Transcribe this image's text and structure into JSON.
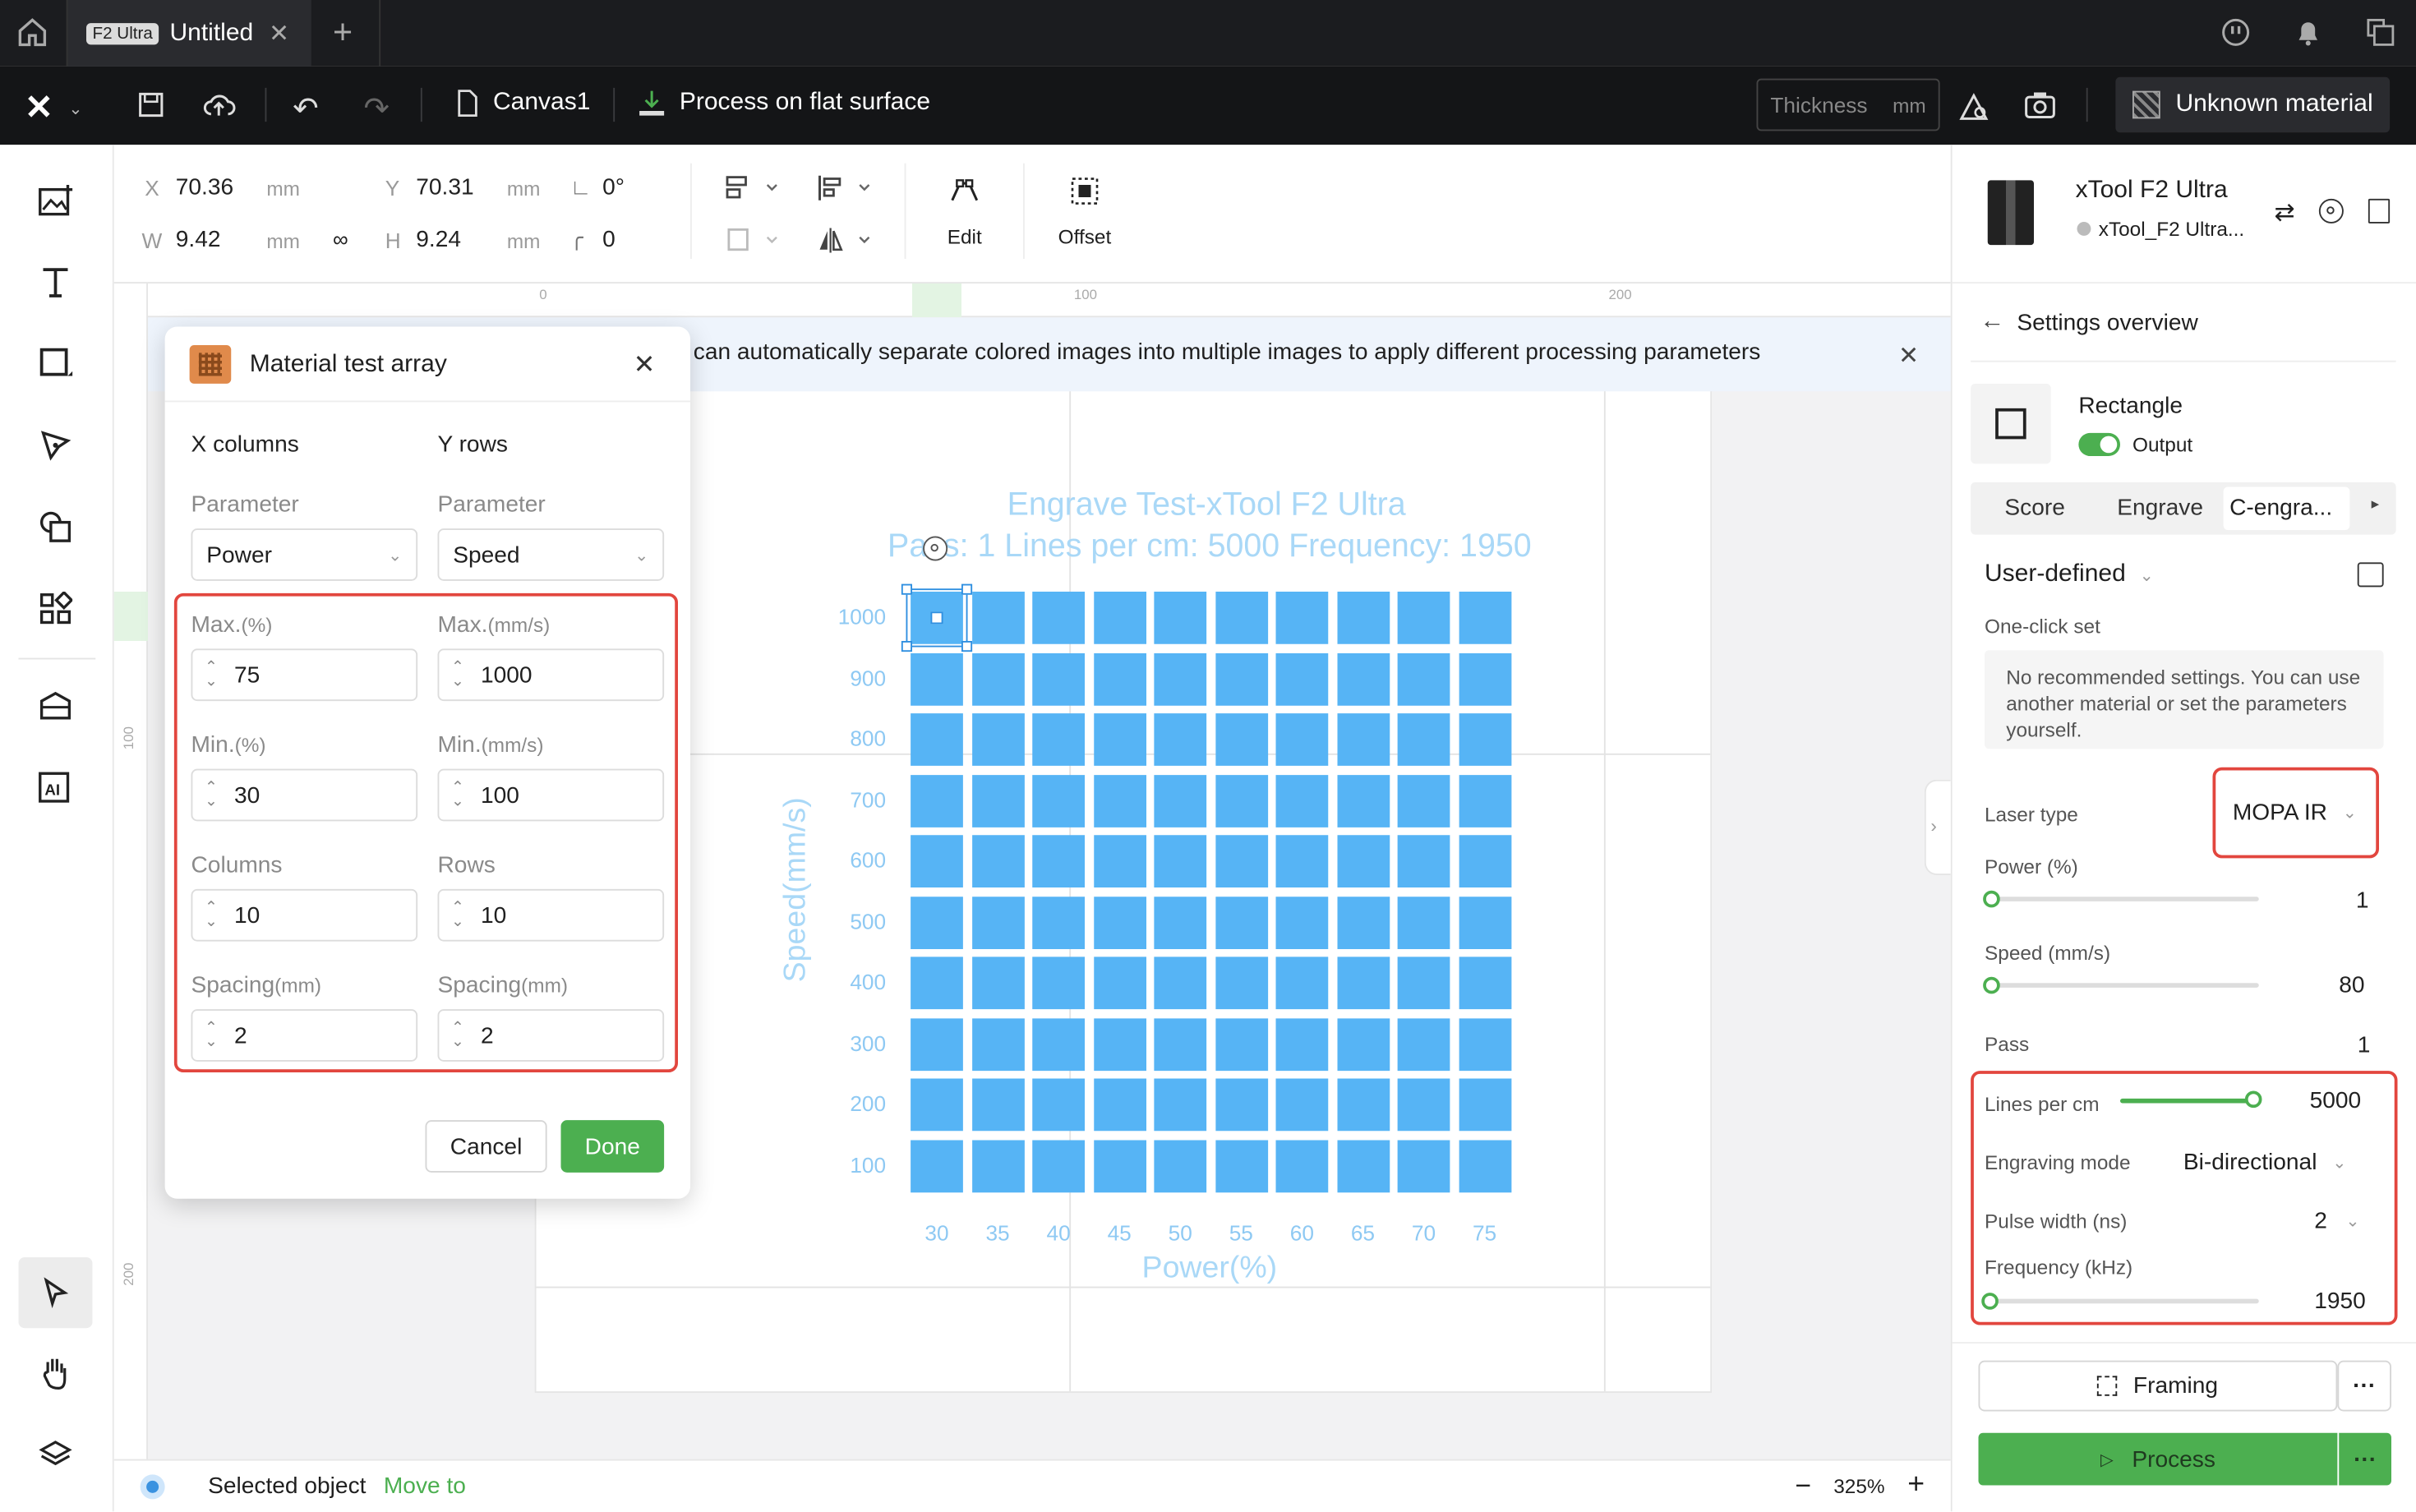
{
  "tabbar": {
    "badge": "F2 Ultra",
    "tab_title": "Untitled"
  },
  "toolbar": {
    "canvas_name": "Canvas1",
    "process_mode": "Process on flat surface",
    "thickness_placeholder": "Thickness",
    "thickness_unit": "mm",
    "material": "Unknown material"
  },
  "props": {
    "x_label": "X",
    "x": "70.36",
    "y_label": "Y",
    "y": "70.31",
    "w_label": "W",
    "w": "9.42",
    "h_label": "H",
    "h": "9.24",
    "unit": "mm",
    "rotation": "0°",
    "corner": "0",
    "edit": "Edit",
    "offset": "Offset"
  },
  "rulers": {
    "h": [
      "0",
      "100",
      "200"
    ],
    "v": [
      "100",
      "200"
    ]
  },
  "banner": {
    "text": "can automatically separate colored images into multiple images to apply different processing parameters"
  },
  "canvas": {
    "title_line1": "Engrave Test-xTool F2 Ultra",
    "title_line2": "Pass: 1 Lines per cm: 5000 Frequency: 1950",
    "y_axis": "Speed(mm/s)",
    "x_axis": "Power(%)",
    "speed_labels": [
      "1000",
      "900",
      "800",
      "700",
      "600",
      "500",
      "400",
      "300",
      "200",
      "100"
    ],
    "power_labels": [
      "30",
      "35",
      "40",
      "45",
      "50",
      "55",
      "60",
      "65",
      "70",
      "75"
    ]
  },
  "dialog": {
    "title": "Material test array",
    "x_columns": "X columns",
    "y_rows": "Y rows",
    "parameter_label": "Parameter",
    "x_param": "Power",
    "y_param": "Speed",
    "x_max_label": "Max.",
    "x_max_unit": "(%)",
    "x_max": "75",
    "y_max_label": "Max.",
    "y_max_unit": "(mm/s)",
    "y_max": "1000",
    "x_min_label": "Min.",
    "x_min_unit": "(%)",
    "x_min": "30",
    "y_min_label": "Min.",
    "y_min_unit": "(mm/s)",
    "y_min": "100",
    "columns_label": "Columns",
    "columns": "10",
    "rows_label": "Rows",
    "rows": "10",
    "spacing_label": "Spacing",
    "spacing_unit": "(mm)",
    "x_spacing": "2",
    "y_spacing": "2",
    "cancel": "Cancel",
    "done": "Done"
  },
  "right_panel": {
    "device_name": "xTool F2 Ultra",
    "device_conn": "xTool_F2 Ultra...",
    "settings_overview": "Settings overview",
    "shape": "Rectangle",
    "output_label": "Output",
    "output_on": true,
    "tabs": [
      "Score",
      "Engrave",
      "C-engra..."
    ],
    "preset": "User-defined",
    "one_click": "One-click set",
    "no_recommend": "No recommended settings. You can use another material or set the parameters yourself.",
    "laser_type_label": "Laser type",
    "laser_type": "MOPA IR",
    "power_label": "Power (%)",
    "power": "1",
    "power_fraction": 0,
    "speed_label": "Speed (mm/s)",
    "speed": "80",
    "speed_fraction": 0,
    "pass_label": "Pass",
    "pass": "1",
    "lpc_label": "Lines per cm",
    "lpc": "5000",
    "lpc_fraction": 1,
    "mode_label": "Engraving mode",
    "mode": "Bi-directional",
    "pulse_label": "Pulse width (ns)",
    "pulse": "2",
    "freq_label": "Frequency (kHz)",
    "freq": "1950",
    "freq_fraction": 0,
    "framing": "Framing",
    "process": "Process",
    "more": "···"
  },
  "status": {
    "selected": "Selected object",
    "move_to": "Move to",
    "zoom": "325%"
  },
  "colors": {
    "accent_green": "#4caf50",
    "cell_blue": "#56b4f5",
    "highlight_red": "#e2463e",
    "dark_bar": "#141517"
  }
}
